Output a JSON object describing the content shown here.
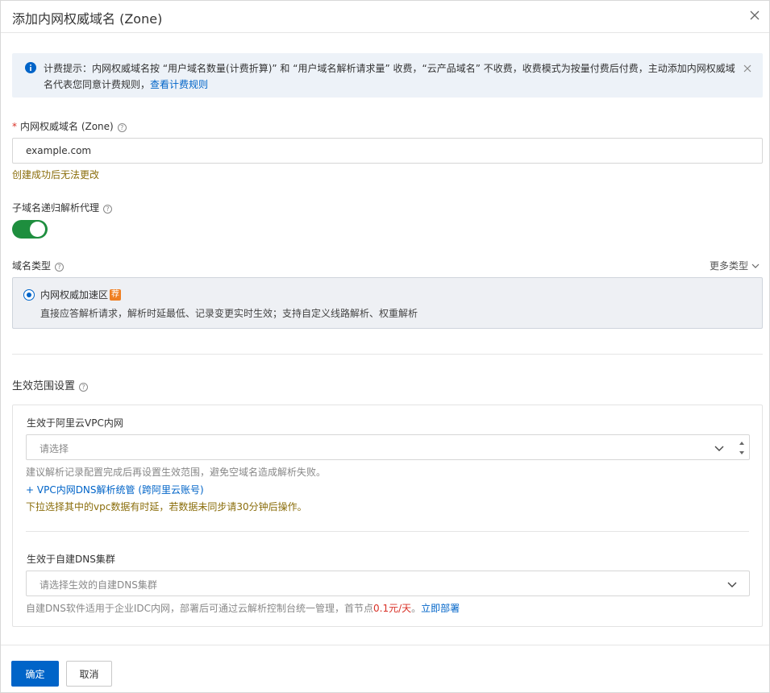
{
  "dialog": {
    "title": "添加内网权威域名 (Zone)"
  },
  "notice": {
    "text": "计费提示：内网权威域名按 “用户域名数量(计费折算)” 和 “用户域名解析请求量” 收费，“云产品域名” 不收费，收费模式为按量付费后付费，主动添加内网权威域名代表您同意计费规则，",
    "link": "查看计费规则"
  },
  "zone_field": {
    "required_mark": "*",
    "label": "内网权威域名 (Zone)",
    "value": "example.com",
    "hint": "创建成功后无法更改"
  },
  "recursion": {
    "label": "子域名递归解析代理",
    "enabled": true
  },
  "domain_type": {
    "label": "域名类型",
    "more_label": "更多类型",
    "option_name": "内网权威加速区",
    "option_badge": "荐",
    "option_desc": "直接应答解析请求，解析时延最低、记录变更实时生效；支持自定义线路解析、权重解析"
  },
  "scope": {
    "title": "生效范围设置",
    "vpc_label": "生效于阿里云VPC内网",
    "vpc_placeholder": "请选择",
    "vpc_hint": "建议解析记录配置完成后再设置生效范围，避免空域名造成解析失败。",
    "vpc_add_link": "+ VPC内网DNS解析统管 (跨阿里云账号)",
    "vpc_delay_hint": "下拉选择其中的vpc数据有时延，若数据未同步请30分钟后操作。",
    "dns_label": "生效于自建DNS集群",
    "dns_placeholder": "请选择生效的自建DNS集群",
    "dns_hint_prefix": "自建DNS软件适用于企业IDC内网，部署后可通过云解析控制台统一管理，首节点",
    "dns_price": "0.1元/天",
    "dns_hint_suffix": "。",
    "dns_deploy_link": "立即部署"
  },
  "footer": {
    "confirm_label": "确定",
    "cancel_label": "取消"
  },
  "colors": {
    "primary": "#0064c8",
    "toggle_on": "#1e8e3e",
    "badge": "#ef7f22",
    "hint_gold": "#8a6d0b",
    "price_red": "#d93026",
    "notice_bg": "#edf2f8"
  },
  "icons": {
    "close": "close-icon",
    "info": "info-circle-icon",
    "help": "question-circle-icon",
    "chevron": "chevron-down-icon"
  }
}
